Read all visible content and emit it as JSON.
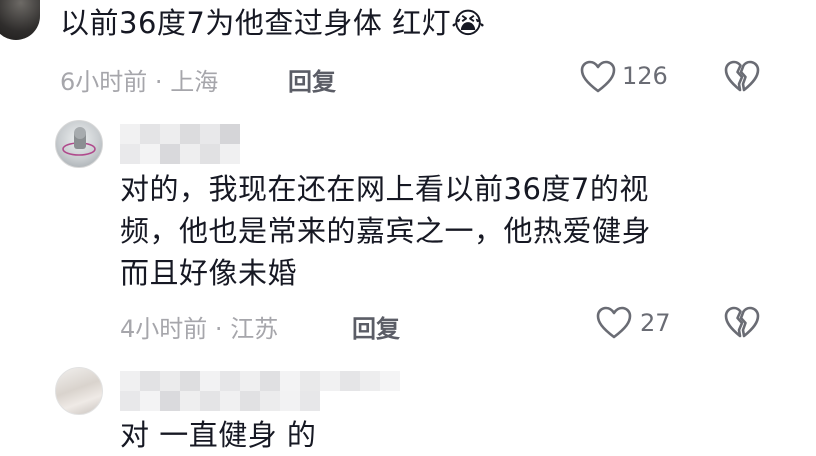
{
  "comments": [
    {
      "text": "以前36度7为他查过身体 红灯😭",
      "time": "6小时前",
      "location": "上海",
      "reply_label": "回复",
      "likes": "126"
    },
    {
      "text_lines": [
        "对的，我现在还在网上看以前36度7的视",
        "频，他也是常来的嘉宾之一，他热爱健身",
        "而且好像未婚"
      ],
      "time": "4小时前",
      "location": "江苏",
      "reply_label": "回复",
      "likes": "27"
    },
    {
      "text": "对 一直健身 的"
    }
  ],
  "separator": "·",
  "icons": {
    "like": "heart-outline-icon",
    "dislike": "broken-heart-icon",
    "emoji": "crying-face-emoji"
  },
  "colors": {
    "text": "#161823",
    "meta": "#a6a6ab",
    "reply": "#5b5d66",
    "icon": "#6a6c74"
  }
}
